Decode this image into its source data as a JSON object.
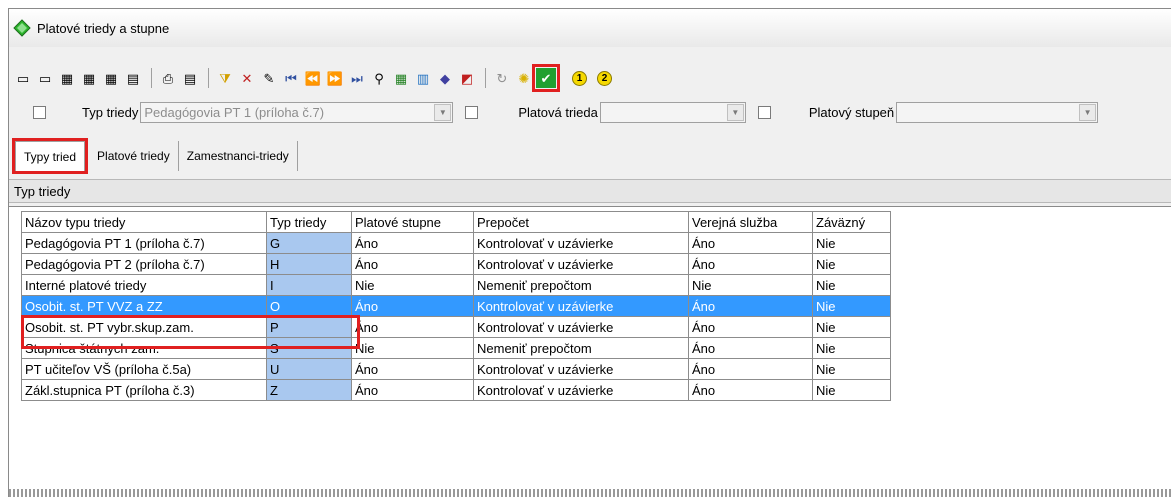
{
  "window": {
    "title": "Platové triedy a stupne"
  },
  "toolbar": {
    "circle1": "1",
    "circle2": "2"
  },
  "filters": {
    "typ_label": "Typ triedy",
    "typ_value": "Pedagógovia PT 1 (príloha č.7)",
    "trieda_label": "Platová trieda",
    "trieda_value": "",
    "stupen_label": "Platový stupeň",
    "stupen_value": ""
  },
  "tabs": [
    {
      "label": "Typy tried"
    },
    {
      "label": "Platové triedy"
    },
    {
      "label": "Zamestnanci-triedy"
    }
  ],
  "section": {
    "label": "Typ triedy"
  },
  "grid": {
    "headers": [
      "Názov typu triedy",
      "Typ triedy",
      "Platové stupne",
      "Prepočet",
      "Verejná služba",
      "Záväzný"
    ],
    "rows": [
      [
        "Pedagógovia PT 1 (príloha č.7)",
        "G",
        "Áno",
        "Kontrolovať v uzávierke",
        "Áno",
        "Nie"
      ],
      [
        "Pedagógovia PT 2 (príloha č.7)",
        "H",
        "Áno",
        "Kontrolovať v uzávierke",
        "Áno",
        "Nie"
      ],
      [
        "Interné platové triedy",
        "I",
        "Nie",
        "Nemeniť prepočtom",
        "Nie",
        "Nie"
      ],
      [
        "Osobit. st. PT VVZ a ZZ",
        "O",
        "Áno",
        "Kontrolovať v uzávierke",
        "Áno",
        "Nie"
      ],
      [
        "Osobit. st. PT vybr.skup.zam.",
        "P",
        "Áno",
        "Kontrolovať v uzávierke",
        "Áno",
        "Nie"
      ],
      [
        "Stupnica štátnych zam.",
        "S",
        "Nie",
        "Nemeniť prepočtom",
        "Áno",
        "Nie"
      ],
      [
        "PT učiteľov VŠ (príloha č.5a)",
        "U",
        "Áno",
        "Kontrolovať v uzávierke",
        "Áno",
        "Nie"
      ],
      [
        "Zákl.stupnica PT (príloha č.3)",
        "Z",
        "Áno",
        "Kontrolovať v uzávierke",
        "Áno",
        "Nie"
      ]
    ]
  },
  "colors": {
    "selected_row": "#3399ff",
    "typ_column": "#a9c8ef",
    "highlight": "#e02020"
  }
}
